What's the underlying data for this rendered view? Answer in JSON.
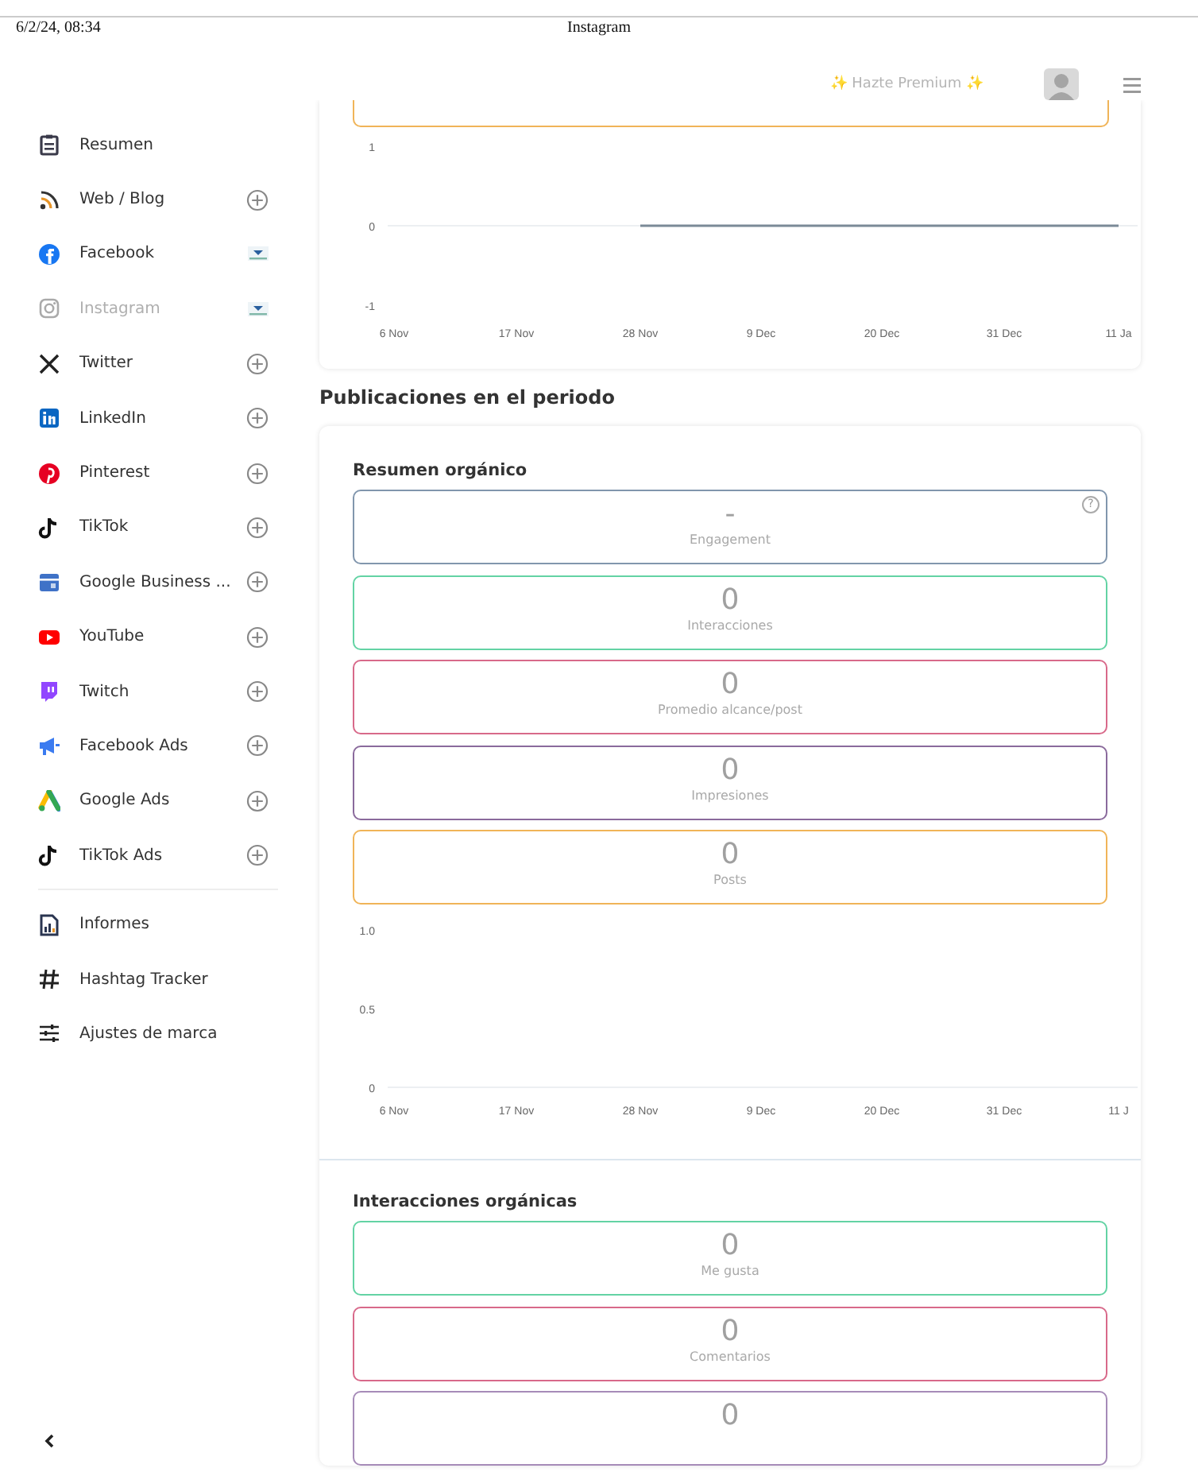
{
  "print_header": {
    "date": "6/2/24, 08:34",
    "title": "Instagram"
  },
  "header": {
    "premium": "✨ Hazte Premium ✨"
  },
  "sidebar": {
    "groups": [
      {
        "items": [
          {
            "kind": "summary",
            "label": "Resumen",
            "add_button": false,
            "connected": false,
            "selected": false
          },
          {
            "kind": "rss",
            "label": "Web / Blog",
            "add_button": true,
            "connected": false,
            "selected": false
          },
          {
            "kind": "facebook",
            "label": "Facebook",
            "add_button": false,
            "connected": true,
            "selected": false
          },
          {
            "kind": "instagram",
            "label": "Instagram",
            "add_button": false,
            "connected": true,
            "selected": true
          },
          {
            "kind": "x",
            "label": "Twitter",
            "add_button": true,
            "connected": false,
            "selected": false
          },
          {
            "kind": "linkedin",
            "label": "LinkedIn",
            "add_button": true,
            "connected": false,
            "selected": false
          },
          {
            "kind": "pinterest",
            "label": "Pinterest",
            "add_button": true,
            "connected": false,
            "selected": false
          },
          {
            "kind": "tiktok",
            "label": "TikTok",
            "add_button": true,
            "connected": false,
            "selected": false
          },
          {
            "kind": "store",
            "label": "Google Business ...",
            "add_button": true,
            "connected": false,
            "selected": false
          },
          {
            "kind": "youtube",
            "label": "YouTube",
            "add_button": true,
            "connected": false,
            "selected": false
          },
          {
            "kind": "twitch",
            "label": "Twitch",
            "add_button": true,
            "connected": false,
            "selected": false
          },
          {
            "kind": "megaphone",
            "label": "Facebook Ads",
            "add_button": true,
            "connected": false,
            "selected": false
          },
          {
            "kind": "googleads",
            "label": "Google Ads",
            "add_button": true,
            "connected": false,
            "selected": false
          },
          {
            "kind": "tiktok",
            "label": "TikTok Ads",
            "add_button": true,
            "connected": false,
            "selected": false
          }
        ]
      },
      {
        "items": [
          {
            "kind": "report",
            "label": "Informes",
            "add_button": false,
            "connected": false,
            "selected": false
          },
          {
            "kind": "hashtag",
            "label": "Hashtag Tracker",
            "add_button": false,
            "connected": false,
            "selected": false
          },
          {
            "kind": "sliders",
            "label": "Ajustes de marca",
            "add_button": false,
            "connected": false,
            "selected": false
          }
        ]
      }
    ]
  },
  "top_chart": {
    "chart_data": {
      "type": "line",
      "categories": [
        "6 Nov",
        "17 Nov",
        "28 Nov",
        "9 Dec",
        "20 Dec",
        "31 Dec",
        "11 Ja"
      ],
      "ylim": [
        -1,
        1
      ],
      "yticks": [
        1,
        0,
        -1
      ],
      "series": [
        {
          "color": "#7b8a97",
          "values": [
            null,
            null,
            0,
            0,
            0,
            0,
            0
          ]
        }
      ]
    }
  },
  "section_title": "Publicaciones en el periodo",
  "panels": [
    {
      "title": "Resumen orgánico",
      "stats": [
        {
          "value": "-",
          "label": "Engagement",
          "color": "#8196ad",
          "help": "?"
        },
        {
          "value": "0",
          "label": "Interacciones",
          "color": "#63d3a4"
        },
        {
          "value": "0",
          "label": "Promedio alcance/post",
          "color": "#d8698a"
        },
        {
          "value": "0",
          "label": "Impresiones",
          "color": "#8a6a9c"
        },
        {
          "value": "0",
          "label": "Posts",
          "color": "#f0b458"
        }
      ],
      "chart_data": {
        "type": "line",
        "categories": [
          "6 Nov",
          "17 Nov",
          "28 Nov",
          "9 Dec",
          "20 Dec",
          "31 Dec",
          "11 J"
        ],
        "ylim": [
          0,
          1
        ],
        "yticks": [
          {
            "value": 1,
            "label": "1.0"
          },
          0.5,
          0
        ]
      }
    },
    {
      "title": "Interacciones orgánicas",
      "stats": [
        {
          "value": "0",
          "label": "Me gusta",
          "color": "#63d3a4"
        },
        {
          "value": "0",
          "label": "Comentarios",
          "color": "#d8698a"
        },
        {
          "value": "0",
          "color": "#a68bb8"
        }
      ]
    }
  ]
}
